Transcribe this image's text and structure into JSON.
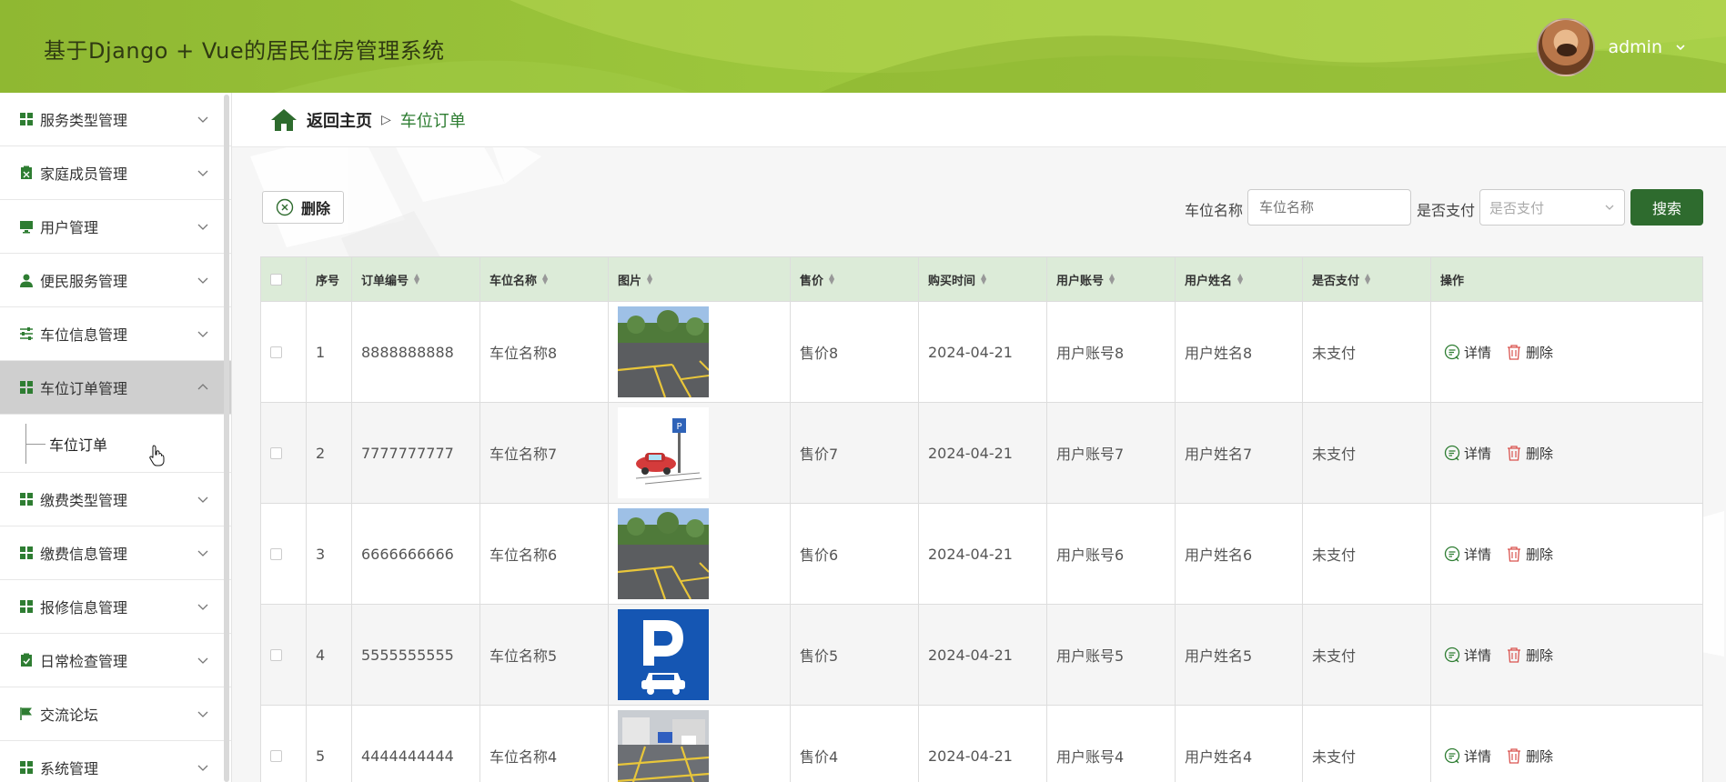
{
  "header": {
    "title": "基于Django + Vue的居民住房管理系统",
    "user_name": "admin",
    "colors": {
      "header": "#9cc63c",
      "accent": "#2e6b2e"
    }
  },
  "sidebar": {
    "items": [
      {
        "label": "服务类型管理",
        "icon": "grid-icon"
      },
      {
        "label": "家庭成员管理",
        "icon": "clipboard-icon"
      },
      {
        "label": "用户管理",
        "icon": "monitor-icon"
      },
      {
        "label": "便民服务管理",
        "icon": "user-icon"
      },
      {
        "label": "车位信息管理",
        "icon": "sliders-icon"
      },
      {
        "label": "车位订单管理",
        "icon": "grid-icon",
        "expanded": true
      },
      {
        "label": "缴费类型管理",
        "icon": "grid-icon"
      },
      {
        "label": "缴费信息管理",
        "icon": "grid-icon"
      },
      {
        "label": "报修信息管理",
        "icon": "grid-icon"
      },
      {
        "label": "日常检查管理",
        "icon": "check-clipboard-icon"
      },
      {
        "label": "交流论坛",
        "icon": "flag-icon"
      },
      {
        "label": "系统管理",
        "icon": "grid-icon"
      }
    ],
    "sub_item": "车位订单"
  },
  "breadcrumb": {
    "home": "返回主页",
    "current": "车位订单"
  },
  "toolbar": {
    "delete_label": "删除",
    "filter1_label": "车位名称",
    "filter1_placeholder": "车位名称",
    "filter2_label": "是否支付",
    "filter2_placeholder": "是否支付",
    "search_label": "搜索"
  },
  "table": {
    "headers": [
      "序号",
      "订单编号",
      "车位名称",
      "图片",
      "售价",
      "购买时间",
      "用户账号",
      "用户姓名",
      "是否支付",
      "操作"
    ],
    "detail_label": "详情",
    "delete_label": "删除",
    "rows": [
      {
        "idx": "1",
        "order": "8888888888",
        "name": "车位名称8",
        "img": "parking-lot-photo",
        "price": "售价8",
        "time": "2024-04-21",
        "account": "用户账号8",
        "uname": "用户姓名8",
        "paid": "未支付"
      },
      {
        "idx": "2",
        "order": "7777777777",
        "name": "车位名称7",
        "img": "car-parking-illustration",
        "price": "售价7",
        "time": "2024-04-21",
        "account": "用户账号7",
        "uname": "用户姓名7",
        "paid": "未支付"
      },
      {
        "idx": "3",
        "order": "6666666666",
        "name": "车位名称6",
        "img": "parking-lot-photo",
        "price": "售价6",
        "time": "2024-04-21",
        "account": "用户账号6",
        "uname": "用户姓名6",
        "paid": "未支付"
      },
      {
        "idx": "4",
        "order": "5555555555",
        "name": "车位名称5",
        "img": "parking-sign",
        "price": "售价5",
        "time": "2024-04-21",
        "account": "用户账号5",
        "uname": "用户姓名5",
        "paid": "未支付"
      },
      {
        "idx": "5",
        "order": "4444444444",
        "name": "车位名称4",
        "img": "parking-street-photo",
        "price": "售价4",
        "time": "2024-04-21",
        "account": "用户账号4",
        "uname": "用户姓名4",
        "paid": "未支付"
      }
    ]
  }
}
